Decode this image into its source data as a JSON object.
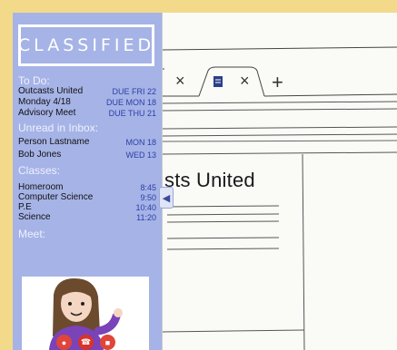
{
  "browser": {
    "tabs": [
      {
        "label": "",
        "close": "×"
      },
      {
        "label": "",
        "close": "×"
      }
    ],
    "new_tab": "+",
    "document_title": "sts United"
  },
  "sidebar": {
    "logo": "CLASSIFIED",
    "todo": {
      "heading": "To Do:",
      "items": [
        {
          "label": "Outcasts United",
          "due": "DUE FRI 22"
        },
        {
          "label": "Monday 4/18",
          "due": "DUE MON 18"
        },
        {
          "label": "Advisory Meet",
          "due": "DUE THU 21"
        }
      ]
    },
    "inbox": {
      "heading": "Unread in Inbox:",
      "items": [
        {
          "label": "Person Lastname",
          "date": "MON 18"
        },
        {
          "label": "Bob Jones",
          "date": "WED 13"
        }
      ]
    },
    "classes": {
      "heading": "Classes:",
      "items": [
        {
          "label": "Homeroom",
          "time": "8:45"
        },
        {
          "label": "Computer Science",
          "time": "9:50"
        },
        {
          "label": "P.E",
          "time": "10:40"
        },
        {
          "label": "Science",
          "time": "11:20"
        }
      ]
    },
    "meet": {
      "heading": "Meet:"
    }
  },
  "colors": {
    "page_bg": "#f3d98a",
    "sidebar_bg": "#a6b3e6",
    "accent_text": "#2b3fa8",
    "mic_button": "#e0443a",
    "end_call_button": "#d9322b",
    "video_button": "#e0443a"
  },
  "icons": {
    "collapse": "chevron-left-icon",
    "tab_doc": "document-icon",
    "meet_controls": [
      "microphone-icon",
      "end-call-icon",
      "video-off-icon"
    ]
  }
}
